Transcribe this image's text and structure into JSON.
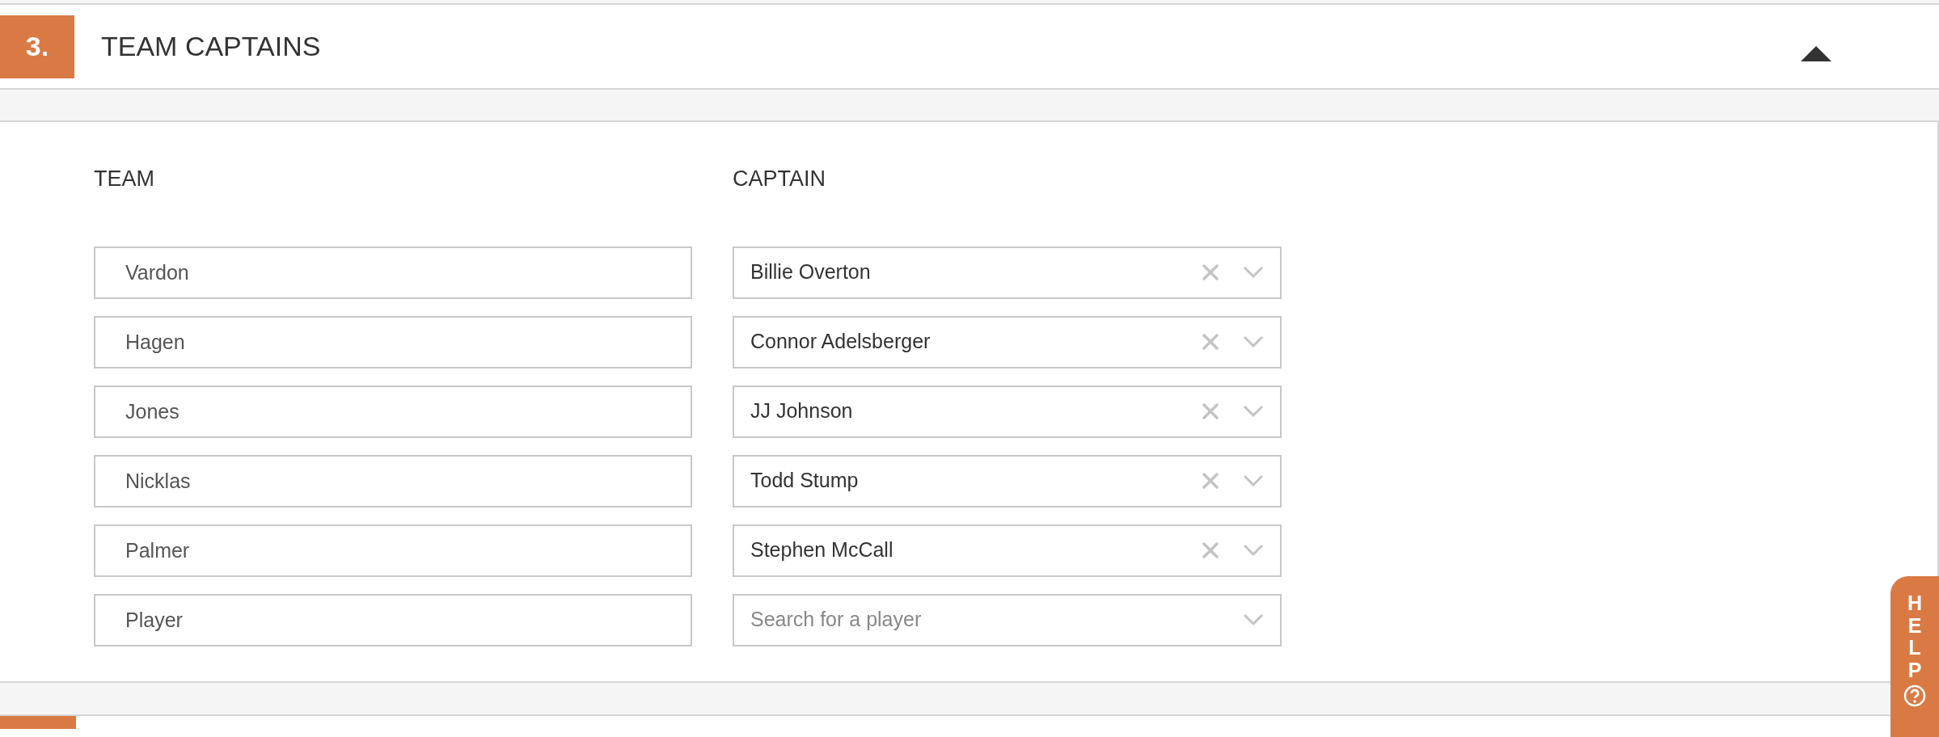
{
  "section": {
    "number": "3.",
    "title": "TEAM CAPTAINS",
    "expanded": true
  },
  "columns": [
    "TEAM",
    "CAPTAIN"
  ],
  "rows": [
    {
      "team": "Vardon",
      "captain": {
        "value": "Billie Overton"
      }
    },
    {
      "team": "Hagen",
      "captain": {
        "value": "Connor Adelsberger"
      }
    },
    {
      "team": "Jones",
      "captain": {
        "value": "JJ Johnson"
      }
    },
    {
      "team": "Nicklas",
      "captain": {
        "value": "Todd Stump"
      }
    },
    {
      "team": "Palmer",
      "captain": {
        "value": "Stephen McCall"
      }
    },
    {
      "team": "Player",
      "captain": {
        "placeholder": "Search for a player"
      }
    }
  ],
  "help": {
    "label": "HELP"
  }
}
